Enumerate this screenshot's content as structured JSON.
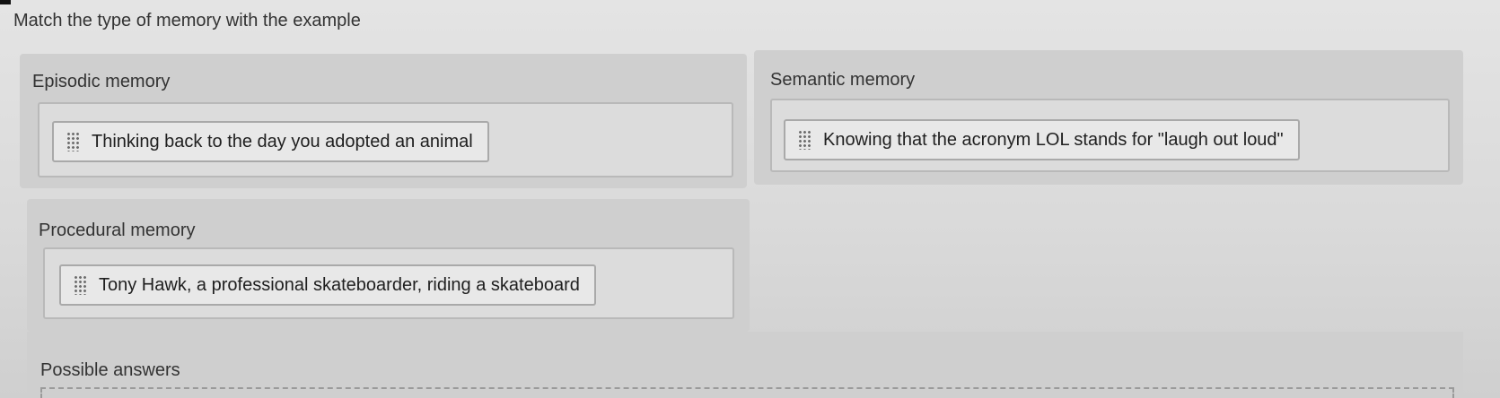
{
  "question": "Match the type of memory with the example",
  "categories": [
    {
      "label": "Episodic memory",
      "answer": "Thinking back to the day you adopted an animal"
    },
    {
      "label": "Semantic memory",
      "answer": "Knowing that the acronym LOL stands for \"laugh out loud\""
    },
    {
      "label": "Procedural memory",
      "answer": "Tony Hawk, a professional skateboarder, riding a skateboard"
    }
  ],
  "possible_answers_label": "Possible answers",
  "icons": {
    "drag_handle": "drag-handle-icon"
  }
}
